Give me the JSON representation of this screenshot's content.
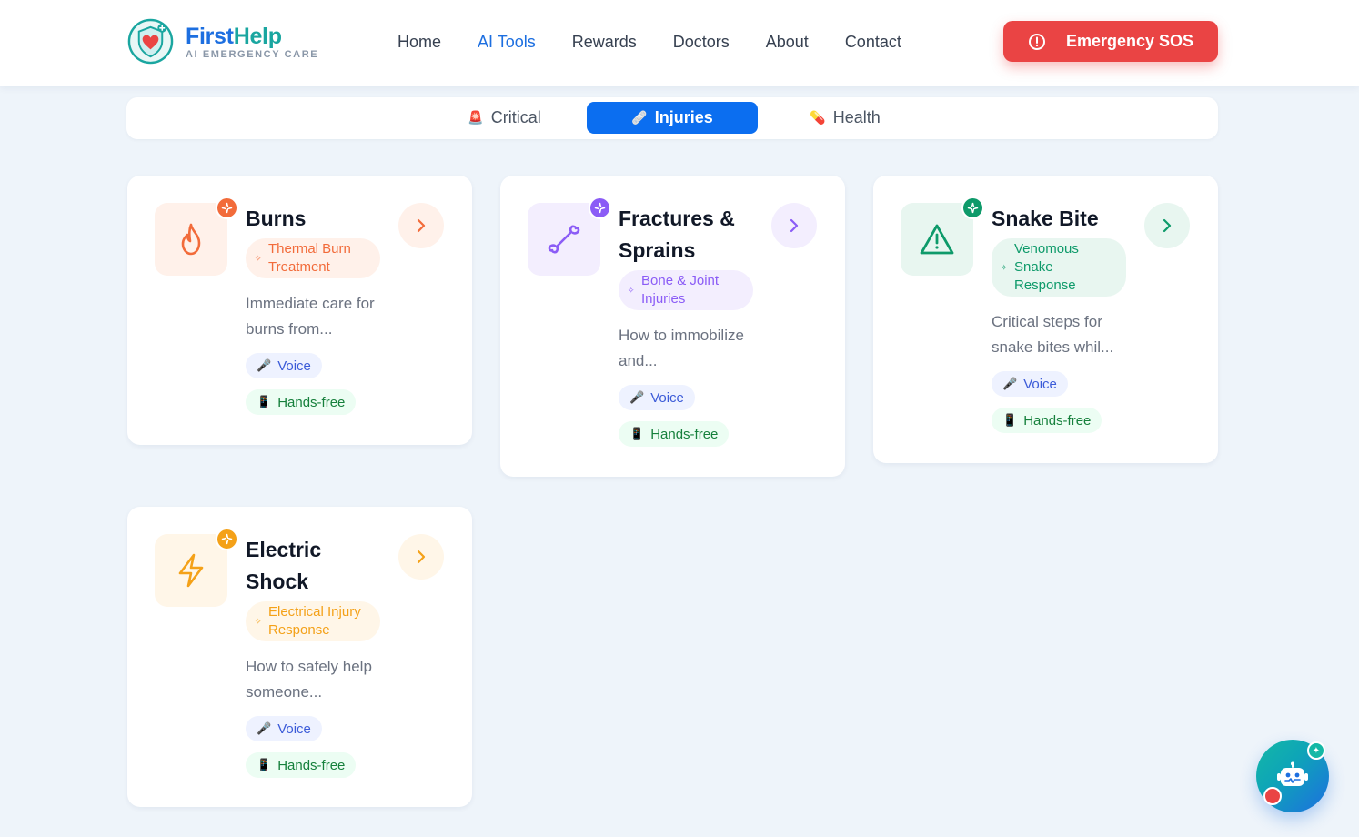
{
  "brand": {
    "title_part1": "First",
    "title_part2": "Help",
    "subtitle": "AI EMERGENCY CARE"
  },
  "nav": {
    "items": [
      {
        "label": "Home",
        "active": false
      },
      {
        "label": "AI Tools",
        "active": true
      },
      {
        "label": "Rewards",
        "active": false
      },
      {
        "label": "Doctors",
        "active": false
      },
      {
        "label": "About",
        "active": false
      },
      {
        "label": "Contact",
        "active": false
      }
    ],
    "sos_label": "Emergency SOS"
  },
  "tabs": [
    {
      "label": "Critical",
      "icon": "🚨",
      "active": false
    },
    {
      "label": "Injuries",
      "icon": "🩹",
      "active": true
    },
    {
      "label": "Health",
      "icon": "💊",
      "active": false
    }
  ],
  "cards": [
    {
      "title": "Burns",
      "tag": "Thermal Burn Treatment",
      "description": "Immediate care for burns from...",
      "icon": "flame-icon",
      "accent": "#f26b3a",
      "accent_bg": "#fff1ea",
      "chips": [
        "Voice",
        "Hands-free"
      ]
    },
    {
      "title": "Fractures & Sprains",
      "tag": "Bone & Joint Injuries",
      "description": "How to immobilize and...",
      "icon": "bone-icon",
      "accent": "#8b5cf6",
      "accent_bg": "#f3eefe",
      "chips": [
        "Voice",
        "Hands-free"
      ]
    },
    {
      "title": "Snake Bite",
      "tag": "Venomous Snake Response",
      "description": "Critical steps for snake bites whil...",
      "icon": "warning-triangle-icon",
      "accent": "#0e9a6a",
      "accent_bg": "#e8f6f0",
      "chips": [
        "Voice",
        "Hands-free"
      ]
    },
    {
      "title": "Electric Shock",
      "tag": "Electrical Injury Response",
      "description": "How to safely help someone...",
      "icon": "lightning-icon",
      "accent": "#f4a118",
      "accent_bg": "#fff6e8",
      "chips": [
        "Voice",
        "Hands-free"
      ]
    }
  ],
  "chip_icons": {
    "voice": "🎤",
    "hands": "📱"
  }
}
